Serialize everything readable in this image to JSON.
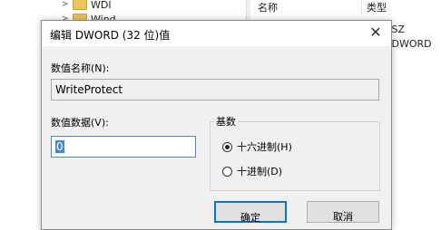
{
  "background": {
    "tree_items": [
      {
        "label": "WDI"
      },
      {
        "label": "Wind"
      }
    ],
    "columns": {
      "name": "名称",
      "type": "类型"
    },
    "type_values": [
      "_SZ",
      "_DWORD"
    ]
  },
  "dialog": {
    "title": "编辑 DWORD (32 位)值",
    "close_label": "✕",
    "value_name_label": "数值名称(N):",
    "value_name": "WriteProtect",
    "value_data_label": "数值数据(V):",
    "value_data": "0",
    "base": {
      "label": "基数",
      "options": [
        {
          "label": "十六进制(H)",
          "checked": true
        },
        {
          "label": "十进制(D)",
          "checked": false
        }
      ]
    },
    "buttons": {
      "ok": "确定",
      "cancel": "取消"
    }
  }
}
